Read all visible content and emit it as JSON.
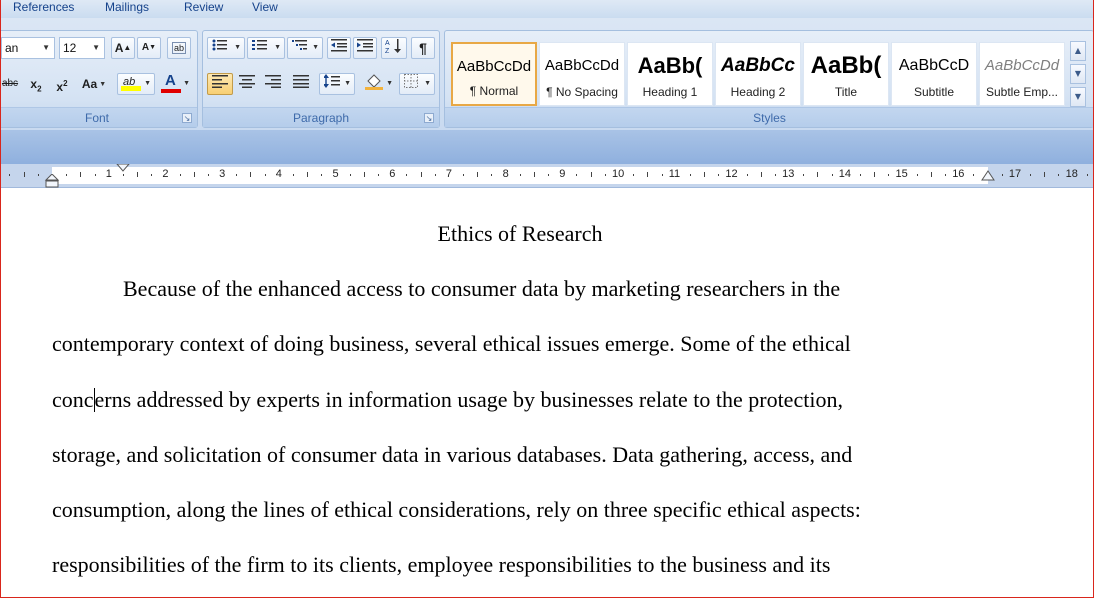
{
  "tabs": [
    "References",
    "Mailings",
    "Review",
    "View"
  ],
  "font_group": {
    "label": "Font",
    "font_name": "an",
    "font_size": "12",
    "grow_label": "A",
    "shrink_label": "A",
    "clear_label": "ab",
    "strike_label": "abc",
    "sub_label": "x",
    "sub_mark": "2",
    "sup_label": "x",
    "sup_mark": "2",
    "case_label": "Aa",
    "highlight_label": "ab",
    "color_label": "A",
    "highlight_color": "#ffff00",
    "font_color": "#e00000"
  },
  "paragraph_group": {
    "label": "Paragraph"
  },
  "styles_group": {
    "label": "Styles",
    "items": [
      {
        "sample": "AaBbCcDd",
        "name": "¶ Normal"
      },
      {
        "sample": "AaBbCcDd",
        "name": "¶ No Spacing"
      },
      {
        "sample": "AaBb(",
        "name": "Heading 1"
      },
      {
        "sample": "AaBbCc",
        "name": "Heading 2"
      },
      {
        "sample": "AaBb(",
        "name": "Title"
      },
      {
        "sample": "AaBbCcD",
        "name": "Subtitle"
      },
      {
        "sample": "AaBbCcDd",
        "name": "Subtle Emp..."
      }
    ]
  },
  "ruler": {
    "numbers": [
      "1",
      "2",
      "3",
      "4",
      "5",
      "6",
      "7",
      "8",
      "9",
      "10",
      "11",
      "12",
      "13",
      "14",
      "15",
      "16",
      "17",
      "18"
    ]
  },
  "document": {
    "title": "Ethics of Research",
    "lines": [
      "Because of the enhanced access to consumer data by marketing researchers in the",
      "contemporary context of doing business, several ethical issues emerge. Some of the ethical",
      "conc",
      "erns addressed by experts in information usage by businesses relate to the protection,",
      "storage, and solicitation of consumer data in various databases. Data gathering, access, and",
      "consumption, along the lines of ethical considerations, rely on three specific ethical aspects:",
      "responsibilities of the firm to its clients, employee responsibilities to the business and its"
    ]
  }
}
